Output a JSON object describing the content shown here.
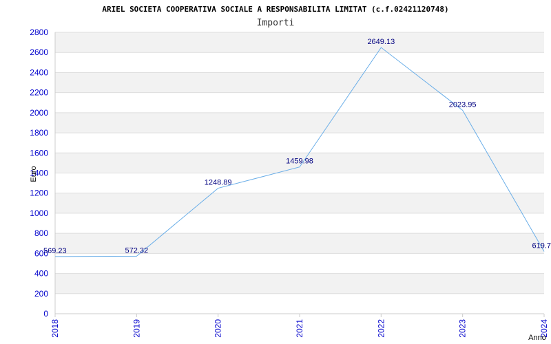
{
  "chart_data": {
    "type": "line",
    "title": "ARIEL SOCIETA COOPERATIVA SOCIALE A RESPONSABILITA LIMITAT (c.f.02421120748)",
    "subtitle": "Importi",
    "xlabel": "Anno",
    "ylabel": "Euro",
    "categories": [
      "2018",
      "2019",
      "2020",
      "2021",
      "2022",
      "2023",
      "2024"
    ],
    "values": [
      569.23,
      572.32,
      1248.89,
      1459.98,
      2649.13,
      2023.95,
      619.7
    ],
    "data_labels": [
      "569.23",
      "572.32",
      "1248.89",
      "1459.98",
      "2649.13",
      "2023.95",
      "619.7"
    ],
    "y_ticks": [
      "0",
      "200",
      "400",
      "600",
      "800",
      "1000",
      "1200",
      "1400",
      "1600",
      "1800",
      "2000",
      "2200",
      "2400",
      "2600",
      "2800"
    ],
    "ylim": [
      0,
      2800
    ],
    "grid": true,
    "line_color": "#6aaee8",
    "band_color": "#f2f2f2",
    "axis_text_color": "#0000cc",
    "label_color": "#000080"
  }
}
